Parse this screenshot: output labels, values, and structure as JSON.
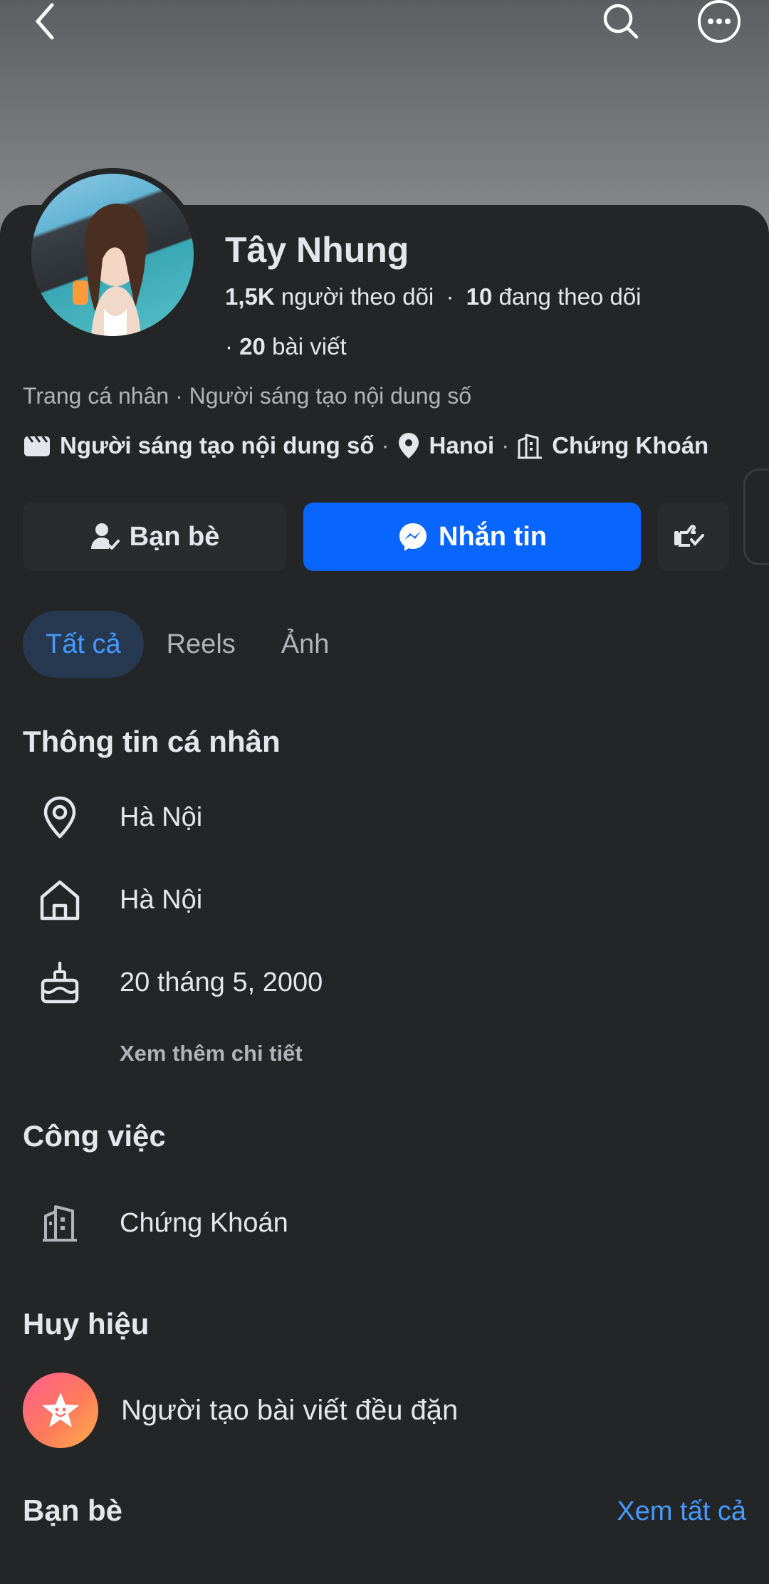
{
  "profile": {
    "name": "Tây Nhung",
    "followers_count": "1,5K",
    "followers_label": "người theo dõi",
    "following_count": "10",
    "following_label": "đang theo dõi",
    "posts_prefix": "·",
    "posts_count": "20",
    "posts_label": "bài viết",
    "subtitle": "Trang cá nhân · Người sáng tạo nội dung số",
    "chips": {
      "creator": "Người sáng tạo nội dung số",
      "location": "Hanoi",
      "work": "Chứng Khoán"
    }
  },
  "actions": {
    "friends_label": "Bạn bè",
    "message_label": "Nhắn tin"
  },
  "tabs": [
    {
      "label": "Tất cả",
      "active": true
    },
    {
      "label": "Reels",
      "active": false
    },
    {
      "label": "Ảnh",
      "active": false
    }
  ],
  "personal_info": {
    "title": "Thông tin cá nhân",
    "current_city": "Hà Nội",
    "hometown": "Hà Nội",
    "birthday": "20 tháng 5, 2000",
    "see_more": "Xem thêm chi tiết"
  },
  "work": {
    "title": "Công việc",
    "company": "Chứng Khoán"
  },
  "badges": {
    "title": "Huy hiệu",
    "badge_label": "Người tạo bài viết đều đặn"
  },
  "friends": {
    "title": "Bạn bè",
    "see_all": "Xem tất cả"
  },
  "colors": {
    "background": "#242526",
    "accent": "#0866ff",
    "link": "#4599ff",
    "active_tab_bg": "#263951"
  }
}
